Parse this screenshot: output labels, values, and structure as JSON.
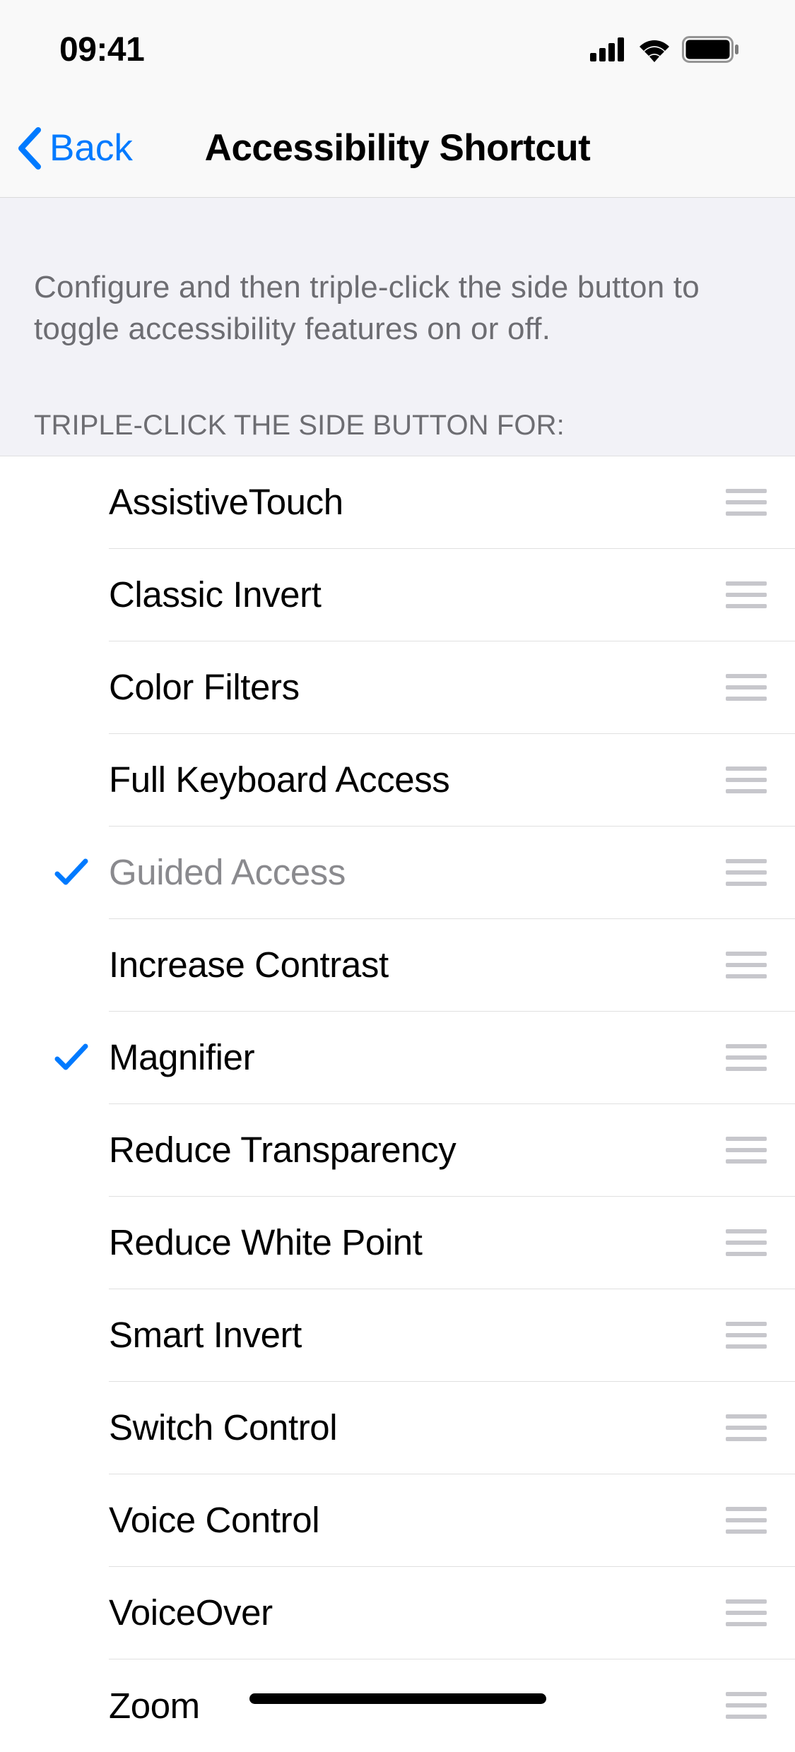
{
  "status": {
    "time": "09:41"
  },
  "nav": {
    "back_label": "Back",
    "title": "Accessibility Shortcut"
  },
  "description": "Configure and then triple-click the side button to toggle accessibility features on or off.",
  "section_header": "TRIPLE-CLICK THE SIDE BUTTON FOR:",
  "items": [
    {
      "label": "AssistiveTouch",
      "checked": false,
      "disabled": false
    },
    {
      "label": "Classic Invert",
      "checked": false,
      "disabled": false
    },
    {
      "label": "Color Filters",
      "checked": false,
      "disabled": false
    },
    {
      "label": "Full Keyboard Access",
      "checked": false,
      "disabled": false
    },
    {
      "label": "Guided Access",
      "checked": true,
      "disabled": true
    },
    {
      "label": "Increase Contrast",
      "checked": false,
      "disabled": false
    },
    {
      "label": "Magnifier",
      "checked": true,
      "disabled": false
    },
    {
      "label": "Reduce Transparency",
      "checked": false,
      "disabled": false
    },
    {
      "label": "Reduce White Point",
      "checked": false,
      "disabled": false
    },
    {
      "label": "Smart Invert",
      "checked": false,
      "disabled": false
    },
    {
      "label": "Switch Control",
      "checked": false,
      "disabled": false
    },
    {
      "label": "Voice Control",
      "checked": false,
      "disabled": false
    },
    {
      "label": "VoiceOver",
      "checked": false,
      "disabled": false
    },
    {
      "label": "Zoom",
      "checked": false,
      "disabled": false
    }
  ],
  "colors": {
    "accent": "#007aff",
    "background": "#f2f2f7",
    "list_bg": "#ffffff",
    "secondary_text": "#6d6d72"
  }
}
